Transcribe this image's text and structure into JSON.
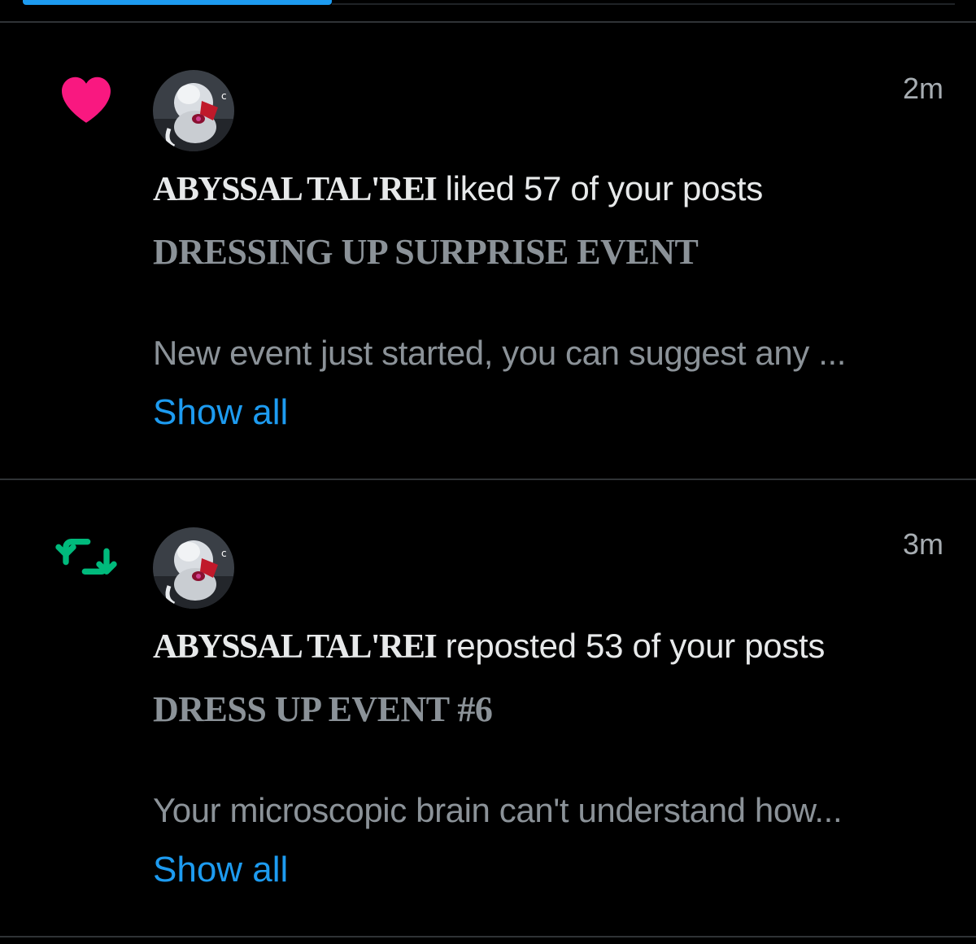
{
  "colors": {
    "background": "#000000",
    "tab_indicator": "#1d9bf0",
    "like": "#f91880",
    "repost": "#00ba7c",
    "link": "#1d9bf0",
    "muted_text": "#8b9298",
    "primary_text": "#e7e9ea"
  },
  "notifications": [
    {
      "type_icon": "heart-icon",
      "time": "2m",
      "actor": "ABYSSAL TAL'REI",
      "action": " liked 57 of your posts",
      "post_title": "DRESSING UP SURPRISE EVENT",
      "excerpt": "New event just started, you can suggest any ...",
      "show_all": "Show all"
    },
    {
      "type_icon": "repost-icon",
      "time": "3m",
      "actor": "ABYSSAL TAL'REI",
      "action": " reposted 53 of your posts",
      "post_title": "DRESS UP EVENT #6",
      "excerpt": "Your microscopic brain can't understand how...",
      "show_all": "Show all"
    }
  ]
}
